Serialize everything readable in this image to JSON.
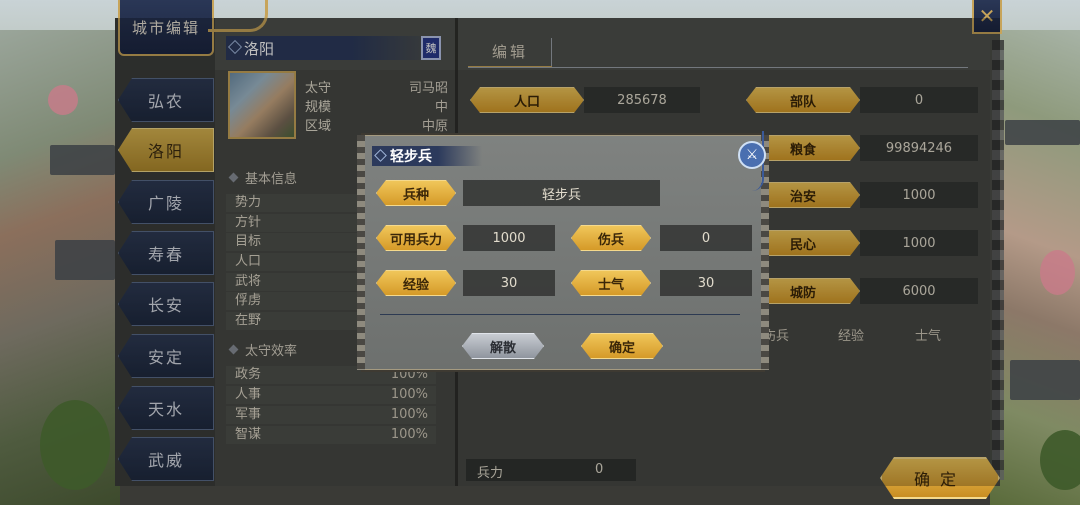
{
  "window": {
    "title": "城市编辑",
    "close_label": "✕"
  },
  "city_tabs": [
    {
      "label": "弘农",
      "active": false
    },
    {
      "label": "洛阳",
      "active": true
    },
    {
      "label": "广陵",
      "active": false
    },
    {
      "label": "寿春",
      "active": false
    },
    {
      "label": "长安",
      "active": false
    },
    {
      "label": "安定",
      "active": false
    },
    {
      "label": "天水",
      "active": false
    },
    {
      "label": "武威",
      "active": false
    }
  ],
  "city": {
    "name": "洛阳",
    "faction_badge": "魏",
    "governor_label": "太守",
    "governor": "司马昭",
    "scale_label": "规模",
    "scale": "中",
    "region_label": "区域",
    "region": "中原"
  },
  "basic_info": {
    "title": "基本信息",
    "rows": [
      {
        "label": "势力"
      },
      {
        "label": "方针"
      },
      {
        "label": "目标"
      },
      {
        "label": "人口"
      },
      {
        "label": "武将"
      },
      {
        "label": "俘虏"
      },
      {
        "label": "在野"
      }
    ]
  },
  "governor_efficiency": {
    "title": "太守效率",
    "rows": [
      {
        "label": "政务",
        "value": "100%"
      },
      {
        "label": "人事",
        "value": "100%"
      },
      {
        "label": "军事",
        "value": "100%"
      },
      {
        "label": "智谋",
        "value": "100%"
      }
    ]
  },
  "edit_panel": {
    "tab_label": "编辑",
    "population_label": "人口",
    "population": "285678",
    "troops_label": "部队",
    "troops": "0",
    "food_label": "粮食",
    "food": "99894246",
    "order_label": "治安",
    "order": "1000",
    "morale_label": "民心",
    "morale": "1000",
    "defense_label": "城防",
    "defense": "6000",
    "columns": [
      "伤兵",
      "经验",
      "士气"
    ],
    "soldiers_label": "兵力",
    "soldiers": "0",
    "confirm_label": "确定"
  },
  "dialog": {
    "title": "轻步兵",
    "unit_type_label": "兵种",
    "unit_type": "轻步兵",
    "available_label": "可用兵力",
    "available": "1000",
    "wounded_label": "伤兵",
    "wounded": "0",
    "exp_label": "经验",
    "exp": "30",
    "morale_label": "士气",
    "morale": "30",
    "disband_label": "解散",
    "confirm_label": "确定"
  },
  "colors": {
    "gold": "#d59a28",
    "navy": "#2c3a5c",
    "panel": "#484a46"
  }
}
